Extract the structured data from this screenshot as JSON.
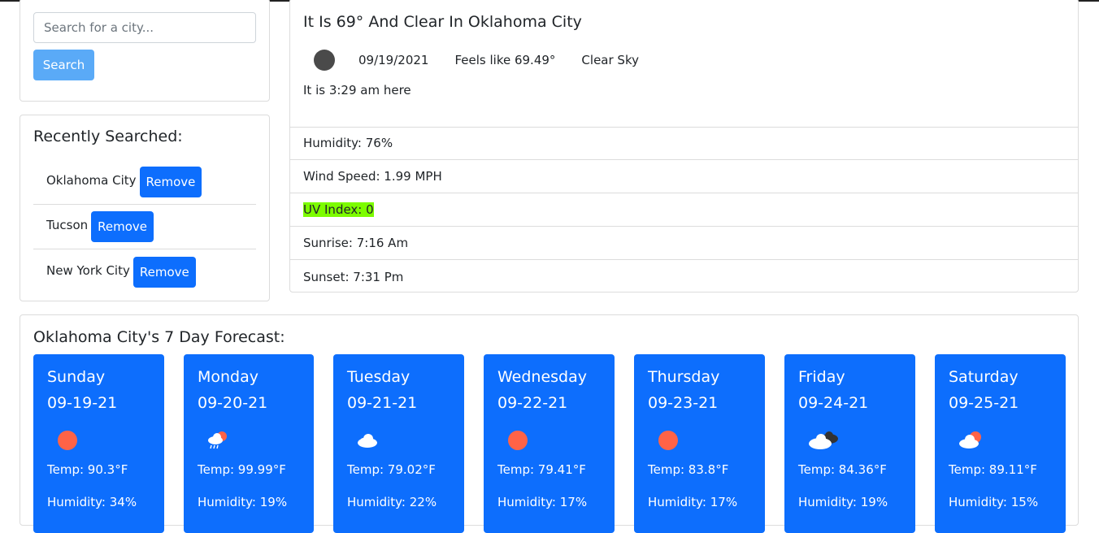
{
  "search": {
    "placeholder": "Search for a city...",
    "button_label": "Search"
  },
  "recent": {
    "title": "Recently Searched:",
    "remove_label": "Remove",
    "items": [
      {
        "city": "Oklahoma City"
      },
      {
        "city": "Tucson"
      },
      {
        "city": "New York City"
      }
    ]
  },
  "current": {
    "title": "It Is 69° And Clear In Oklahoma City",
    "icon": "clear-night-icon",
    "date": "09/19/2021",
    "feels_like": "Feels like 69.49°",
    "condition": "Clear Sky",
    "local_time": "It is 3:29 am here",
    "details": {
      "humidity": "Humidity: 76%",
      "wind": "Wind Speed: 1.99 MPH",
      "uv": "UV Index: 0",
      "sunrise": "Sunrise: 7:16 Am",
      "sunset": "Sunset: 7:31 Pm"
    },
    "uv_color": "#7cfc00"
  },
  "forecast": {
    "title": "Oklahoma City's 7 Day Forecast:",
    "card_color": "#0d6efd",
    "days": [
      {
        "day": "Sunday",
        "date": "09-19-21",
        "icon": "clear-sun-icon",
        "temp": "Temp: 90.3°F",
        "humidity": "Humidity: 34%"
      },
      {
        "day": "Monday",
        "date": "09-20-21",
        "icon": "rain-sun-icon",
        "temp": "Temp: 99.99°F",
        "humidity": "Humidity: 19%"
      },
      {
        "day": "Tuesday",
        "date": "09-21-21",
        "icon": "cloud-icon",
        "temp": "Temp: 79.02°F",
        "humidity": "Humidity: 22%"
      },
      {
        "day": "Wednesday",
        "date": "09-22-21",
        "icon": "clear-sun-icon",
        "temp": "Temp: 79.41°F",
        "humidity": "Humidity: 17%"
      },
      {
        "day": "Thursday",
        "date": "09-23-21",
        "icon": "clear-sun-icon",
        "temp": "Temp: 83.8°F",
        "humidity": "Humidity: 17%"
      },
      {
        "day": "Friday",
        "date": "09-24-21",
        "icon": "broken-clouds-icon",
        "temp": "Temp: 84.36°F",
        "humidity": "Humidity: 19%"
      },
      {
        "day": "Saturday",
        "date": "09-25-21",
        "icon": "partly-cloudy-icon",
        "temp": "Temp: 89.11°F",
        "humidity": "Humidity: 15%"
      }
    ]
  }
}
